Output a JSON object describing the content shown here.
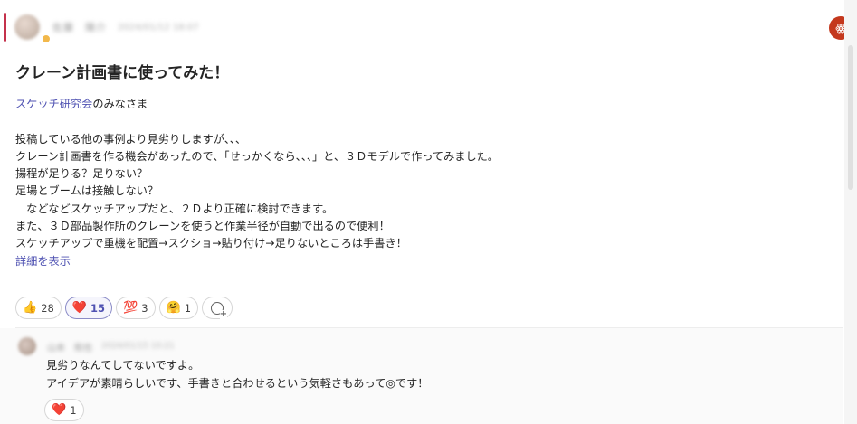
{
  "post": {
    "author": {
      "name": "佐藤　陽介",
      "time": "2024/01/12 18:07"
    },
    "title": "クレーン計画書に使ってみた！",
    "greeting_link": "スケッチ研究会",
    "greeting_rest": "のみなさま",
    "lines": [
      "投稿している他の事例より見劣りしますが、、、",
      "クレーン計画書を作る機会があったので、「せっかくなら、、、」と、３Ｄモデルで作ってみました。",
      "揚程が足りる？足りない？",
      "足場とブームは接触しない？",
      "　などなどスケッチアップだと、２Ｄより正確に検討できます。",
      "また、３Ｄ部品製作所のクレーンを使うと作業半径が自動で出るので便利！",
      "スケッチアップで重機を配置→スクショ→貼り付け→足りないところは手書き！"
    ],
    "see_more": "詳細を表示",
    "reactions": [
      {
        "emoji": "👍",
        "icon": "thumbs-up-icon",
        "count": "28"
      },
      {
        "emoji": "❤️",
        "icon": "heart-icon",
        "count": "15"
      },
      {
        "emoji": "💯",
        "icon": "hundred-points-icon",
        "count": "3"
      },
      {
        "emoji": "🤗",
        "icon": "hugging-face-icon",
        "count": "1"
      }
    ]
  },
  "reply": {
    "author": {
      "name": "山本　和也",
      "time": "2024/01/15 10:21"
    },
    "lines": [
      "見劣りなんてしてないですよ。",
      "アイデアが素晴らしいです、手書きと合わせるという気軽さもあって◎です！"
    ],
    "reactions": [
      {
        "emoji": "❤️",
        "icon": "heart-icon",
        "count": "1"
      }
    ]
  },
  "side_button": {
    "icon": "people-icon",
    "glyph": "ꙮ"
  },
  "colors": {
    "accent": "#c4314b",
    "link": "#4f52b2",
    "side_button": "#c4381d"
  }
}
